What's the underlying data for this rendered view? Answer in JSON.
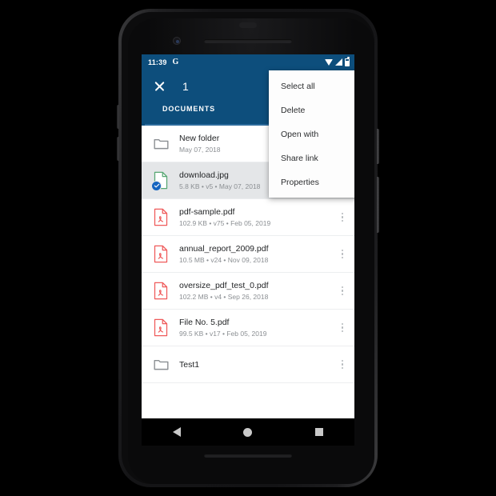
{
  "status_bar": {
    "time": "11:39",
    "google_badge": "G",
    "icons": [
      "wifi-icon",
      "signal-icon",
      "battery-icon"
    ]
  },
  "app_bar": {
    "close_icon": "close-icon",
    "selected_count": "1",
    "cloud_download_icon": "cloud-download-icon",
    "overflow_icon": "overflow-menu-icon",
    "tabs": [
      {
        "label": "DOCUMENTS",
        "active": true
      }
    ]
  },
  "colors": {
    "app_bar_blue": "#0d4e7c",
    "tab_indicator": "#2d6b9c",
    "selected_row": "#e4e6e8",
    "pdf_icon": "#ef5b5b",
    "image_icon": "#57a773",
    "check_badge": "#1565c0",
    "folder_icon": "#8b8f93"
  },
  "dropdown_menu": {
    "items": [
      {
        "label": "Select all"
      },
      {
        "label": "Delete"
      },
      {
        "label": "Open with"
      },
      {
        "label": "Share link"
      },
      {
        "label": "Properties"
      }
    ]
  },
  "file_list": {
    "rows": [
      {
        "name": "New folder",
        "meta": "May 07, 2018",
        "icon": "folder-icon",
        "selected": false,
        "has_more": false
      },
      {
        "name": "download.jpg",
        "meta": "5.8 KB • v5 • May 07, 2018",
        "icon": "image-file-icon",
        "selected": true,
        "has_more": true
      },
      {
        "name": "pdf-sample.pdf",
        "meta": "102.9 KB • v75 • Feb 05, 2019",
        "icon": "pdf-file-icon",
        "selected": false,
        "has_more": true
      },
      {
        "name": "annual_report_2009.pdf",
        "meta": "10.5 MB • v24 • Nov 09, 2018",
        "icon": "pdf-file-icon",
        "selected": false,
        "has_more": true
      },
      {
        "name": "oversize_pdf_test_0.pdf",
        "meta": "102.2 MB • v4 • Sep 26, 2018",
        "icon": "pdf-file-icon",
        "selected": false,
        "has_more": true
      },
      {
        "name": "File No. 5.pdf",
        "meta": "99.5 KB • v17 • Feb 05, 2019",
        "icon": "pdf-file-icon",
        "selected": false,
        "has_more": true
      },
      {
        "name": "Test1",
        "meta": "",
        "icon": "folder-icon",
        "selected": false,
        "has_more": true
      }
    ]
  },
  "nav_bar": {
    "back_icon": "nav-back-icon",
    "home_icon": "nav-home-icon",
    "recents_icon": "nav-recents-icon"
  }
}
